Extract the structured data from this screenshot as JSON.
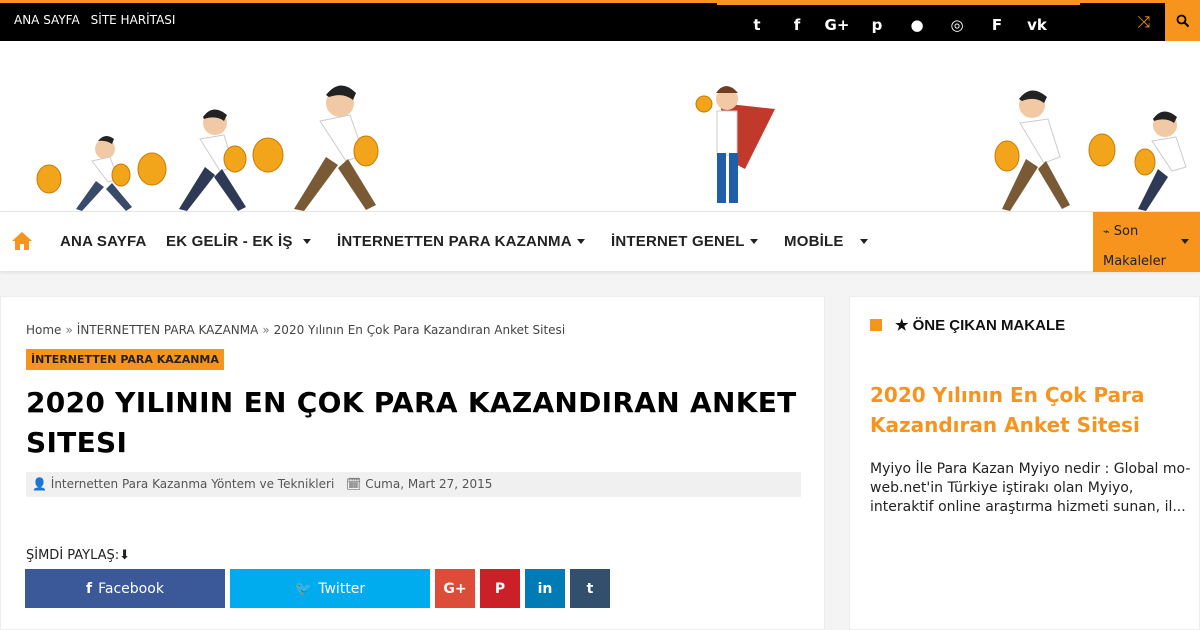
{
  "topbar": {
    "links": [
      "ANA SAYFA",
      "SİTE HARİTASI"
    ],
    "social": [
      {
        "icon": "twitter-icon",
        "glyph": "t"
      },
      {
        "icon": "facebook-icon",
        "glyph": "f"
      },
      {
        "icon": "google-plus-icon",
        "glyph": "G+"
      },
      {
        "icon": "pinterest-icon",
        "glyph": "p"
      },
      {
        "icon": "github-icon",
        "glyph": "●"
      },
      {
        "icon": "dribbble-icon",
        "glyph": "◎"
      },
      {
        "icon": "foursquare-icon",
        "glyph": "F"
      },
      {
        "icon": "vk-icon",
        "glyph": "vk"
      }
    ],
    "shuffle_glyph": "⤨",
    "accent": "#f7941d"
  },
  "nav": {
    "items": [
      "ANA SAYFA",
      "EK GELİR - EK İŞ",
      "İNTERNETTEN PARA KAZANMA",
      "İNTERNET GENEL",
      "MOBİLE"
    ],
    "recent_label": "Son Makaleler",
    "rss_glyph": "☰"
  },
  "article": {
    "breadcrumb": [
      "Home",
      "İNTERNETTEN PARA KAZANMA",
      "2020 Yılının En Çok Para Kazandıran Anket Sitesi"
    ],
    "breadcrumb_sep": "»",
    "category": "İNTERNETTEN PARA KAZANMA",
    "title": "2020 YILININ EN ÇOK PARA KAZANDIRAN ANKET SITESI",
    "author": "İnternetten Para Kazanma Yöntem ve Teknikleri",
    "date": "Cuma, Mart 27, 2015",
    "share_label": "ŞİMDİ PAYLAŞ:⬇"
  },
  "share": [
    {
      "label": "Facebook",
      "glyph": "f",
      "color": "#3b5998",
      "icon": "facebook-icon"
    },
    {
      "label": "Twitter",
      "glyph": "🐦",
      "color": "#00aced",
      "icon": "twitter-icon"
    },
    {
      "label": "",
      "glyph": "G+",
      "color": "#dd4b39",
      "icon": "google-plus-icon"
    },
    {
      "label": "",
      "glyph": "P",
      "color": "#cb2027",
      "icon": "pinterest-icon"
    },
    {
      "label": "",
      "glyph": "in",
      "color": "#007bb6",
      "icon": "linkedin-icon"
    },
    {
      "label": "",
      "glyph": "t",
      "color": "#32506d",
      "icon": "tumblr-icon"
    }
  ],
  "sidebar": {
    "heading": "★ ÖNE ÇIKAN MAKALE",
    "title": "2020 Yılının En Çok Para Kazandıran Anket Sitesi",
    "excerpt": "Myiyo İle Para Kazan Myiyo nedir : Global mo-web.net'in Türkiye iştirakı olan Myiyo, interaktif online araştırma hizmeti sunan, il..."
  }
}
